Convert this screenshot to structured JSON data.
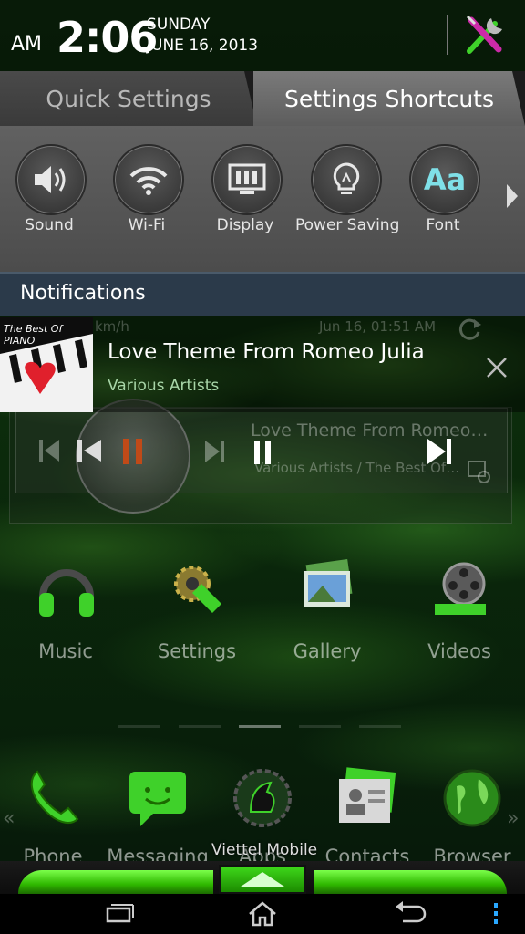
{
  "status_bar": {
    "ampm": "AM",
    "time": "2:06",
    "day": "SUNDAY",
    "date": "JUNE 16, 2013",
    "tools_icon": "wrench-screwdriver-icon"
  },
  "tabs": [
    {
      "label": "Quick Settings",
      "active": false
    },
    {
      "label": "Settings Shortcuts",
      "active": true
    }
  ],
  "shortcuts": [
    {
      "label": "Sound",
      "icon": "speaker-icon"
    },
    {
      "label": "Wi-Fi",
      "icon": "wifi-icon"
    },
    {
      "label": "Display",
      "icon": "display-icon"
    },
    {
      "label": "Power Saving",
      "icon": "lightbulb-icon"
    },
    {
      "label": "Font",
      "icon": "font-icon",
      "glyph": "Aa"
    }
  ],
  "notifications": {
    "header": "Notifications",
    "music": {
      "album_text": "The Best Of PIANO",
      "title": "Love Theme From Romeo Julia",
      "artist": "Various Artists",
      "ghost_speed": "km/h",
      "ghost_date": "Jun 16, 01:51 AM"
    }
  },
  "music_widget": {
    "title": "Love Theme From Romeo…",
    "subtitle": "Various Artists / The Best Of…"
  },
  "home_apps": [
    {
      "label": "Music",
      "icon": "headphones-icon"
    },
    {
      "label": "Settings",
      "icon": "settings-gear-icon"
    },
    {
      "label": "Gallery",
      "icon": "gallery-icon"
    },
    {
      "label": "Videos",
      "icon": "film-reel-icon"
    }
  ],
  "dock": [
    {
      "label": "Phone",
      "icon": "phone-icon"
    },
    {
      "label": "Messaging",
      "icon": "messaging-icon"
    },
    {
      "label": "Apps",
      "icon": "apps-icon"
    },
    {
      "label": "Contacts",
      "icon": "contacts-icon"
    },
    {
      "label": "Browser",
      "icon": "globe-icon"
    }
  ],
  "carrier": "Viettel Mobile",
  "colors": {
    "accent_green": "#3ed81a",
    "font_glyph": "#7fe0e8",
    "notif_header_bg": "#2b3a4a"
  }
}
